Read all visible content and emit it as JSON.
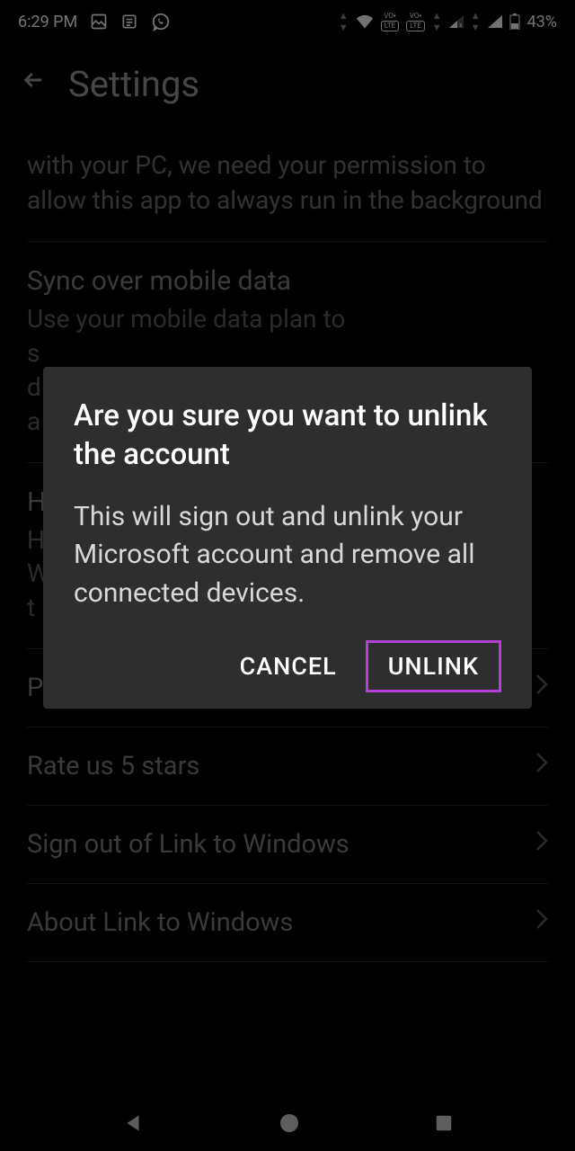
{
  "statusBar": {
    "time": "6:29 PM",
    "battery": "43%"
  },
  "appBar": {
    "title": "Settings"
  },
  "settings": {
    "backgroundPermission": "with your PC, we need your permission to allow this app to always run in the background",
    "syncTitle": "Sync over mobile data",
    "syncDescription": "Use your mobile data plan to s\nd\na",
    "helpTitle": "H",
    "helpDescription": "H\nW\nt",
    "feedbackLabel": "Provide feedback",
    "rateLabel": "Rate us 5 stars",
    "signOutLabel": "Sign out of Link to Windows",
    "aboutLabel": "About Link to Windows"
  },
  "dialog": {
    "title": "Are you sure you want to unlink the account",
    "body": "This will sign out and unlink your Microsoft account and remove all connected devices.",
    "cancelLabel": "CANCEL",
    "unlinkLabel": "UNLINK"
  }
}
